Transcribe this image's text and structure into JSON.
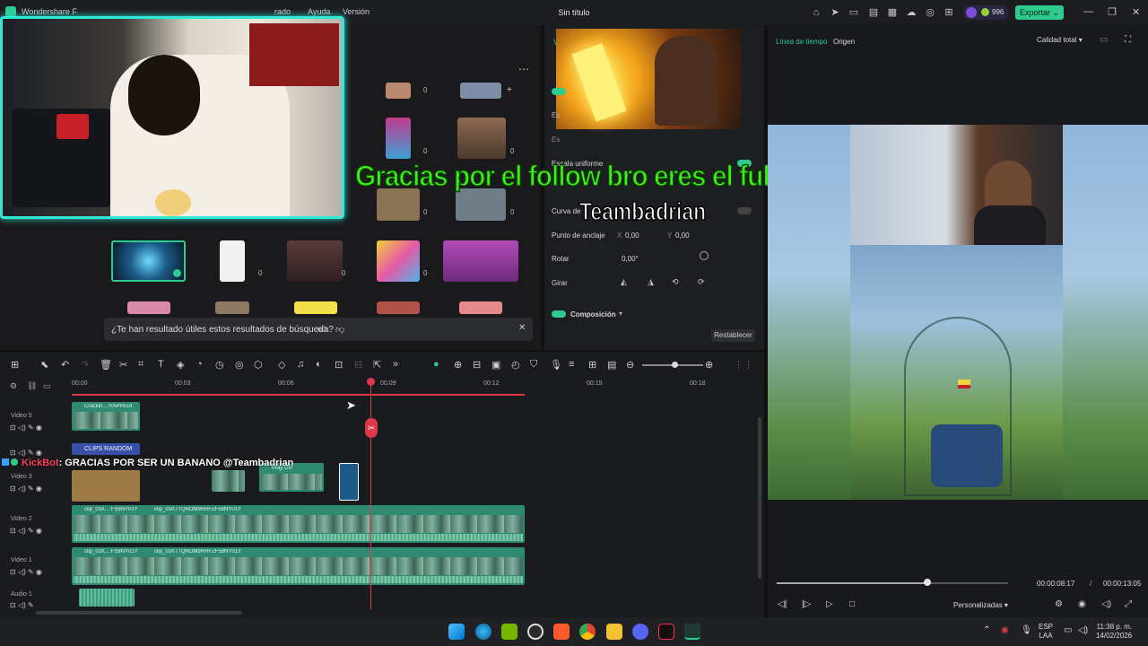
{
  "titlebar": {
    "app_name": "Wondershare F",
    "menu": [
      "rado",
      "Ayuda",
      "Versión"
    ],
    "doc_title": "Sin título",
    "credits": "996",
    "export_label": "Exportar"
  },
  "media": {
    "feedback_text": "¿Te han resultado útiles estos resultados de búsqueda?",
    "count_label": "0"
  },
  "props": {
    "uniform_scale": "Escala uniforme",
    "curve": "Curva de",
    "anchor": "Punto de anclaje",
    "anchor_x_label": "X",
    "anchor_x": "0,00",
    "anchor_y_label": "Y",
    "anchor_y": "0,00",
    "rotate": "Rotar",
    "rotate_val": "0,00°",
    "flip": "Girar",
    "composition": "Composición",
    "reset": "Restablecer"
  },
  "overlay": {
    "green_text": "Gracias por el follow bro eres el fukin madafaka",
    "white_text": "Teambadrian"
  },
  "player": {
    "tab_timeline": "Línea de tiempo",
    "tab_origin": "Origen",
    "quality": "Calidad total",
    "current_time": "00:00:08:17",
    "separator": "/",
    "total_time": "00:00:13:05",
    "preset": "Personalizadas",
    "progress": 0.65
  },
  "timeline": {
    "ticks": [
      "00:00",
      "00:03",
      "00:06",
      "00:09",
      "00:12",
      "00:15",
      "00:18"
    ],
    "tracks": [
      {
        "label": "Video 5"
      },
      {
        "label": "Video 3"
      },
      {
        "label": "Video 2"
      },
      {
        "label": "Video 1"
      },
      {
        "label": "Audio 1"
      }
    ],
    "clips": {
      "v5_title": "Crackin... RAPPEDI",
      "v4_title": "CLIPS RANDOM",
      "v3_gif": "Pray GIF",
      "v2_a": "clip_01K... FS9NY01Y",
      "v2_b": "clip_01K7TQRDM9RRFZF59NY01Y",
      "v1_a": "clip_01K... FS9NY01Y",
      "v1_b": "clip_01K7TQRDM9RRFZF59NY01Y"
    }
  },
  "chat": {
    "user": "KickBot",
    "message": ": GRACIAS POR SER UN BANANO @Teambadrian"
  },
  "tray": {
    "lang1": "ESP",
    "lang2": "LAA",
    "time": "11:38 p. m.",
    "date": "14/02/2026"
  },
  "colors": {
    "accent": "#2ecb8f",
    "playhead": "#e03a4a",
    "overlay_green": "#3df21a",
    "webcam_border": "#2fe8d6"
  }
}
